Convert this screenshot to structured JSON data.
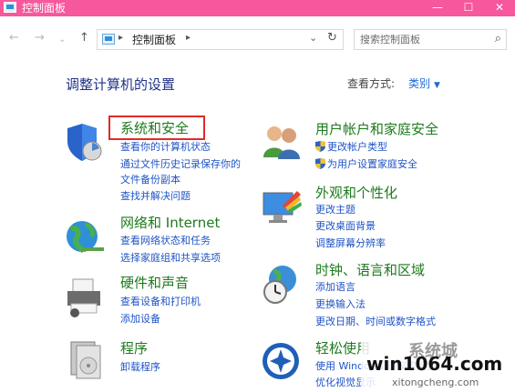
{
  "window": {
    "title": "控制面板",
    "controls": {
      "minimize": "—",
      "maximize": "☐",
      "close": "✕"
    }
  },
  "nav": {
    "back": "←",
    "forward": "→",
    "recent": "⌄",
    "up": "↑",
    "breadcrumb": "控制面板",
    "refresh": "↻",
    "search_placeholder": "搜索控制面板"
  },
  "main": {
    "heading": "调整计算机的设置",
    "view_by_label": "查看方式:",
    "view_by_value": "类别"
  },
  "categories": [
    {
      "title": "系统和安全",
      "icon": "shield-icon",
      "links": [
        "查看你的计算机状态",
        "通过文件历史记录保存你的",
        "文件备份副本",
        "查找并解决问题"
      ]
    },
    {
      "title": "网络和 Internet",
      "icon": "network-icon",
      "links": [
        "查看网络状态和任务",
        "选择家庭组和共享选项"
      ]
    },
    {
      "title": "硬件和声音",
      "icon": "printer-icon",
      "links": [
        "查看设备和打印机",
        "添加设备"
      ]
    },
    {
      "title": "程序",
      "icon": "programs-icon",
      "links": [
        "卸载程序"
      ]
    },
    {
      "title": "用户帐户和家庭安全",
      "icon": "users-icon",
      "links": [
        "更改帐户类型",
        "为用户设置家庭安全"
      ]
    },
    {
      "title": "外观和个性化",
      "icon": "display-icon",
      "links": [
        "更改主题",
        "更改桌面背景",
        "调整屏幕分辨率"
      ]
    },
    {
      "title": "时钟、语言和区域",
      "icon": "clock-globe-icon",
      "links": [
        "添加语言",
        "更换输入法",
        "更改日期、时间或数字格式"
      ]
    },
    {
      "title": "轻松使用",
      "icon": "ease-of-access-icon",
      "links": [
        "使用 Windows 建议的设置",
        "优化视觉显示"
      ]
    }
  ],
  "watermark": {
    "brand": "系统城",
    "site": "win1064.com",
    "domain": "xitongcheng.com"
  },
  "colors": {
    "titlebar": "#f7579c",
    "category_title": "#1d7a1d",
    "link": "#1f54c7",
    "heading": "#1e3287",
    "highlight_box": "#e02a2a"
  }
}
